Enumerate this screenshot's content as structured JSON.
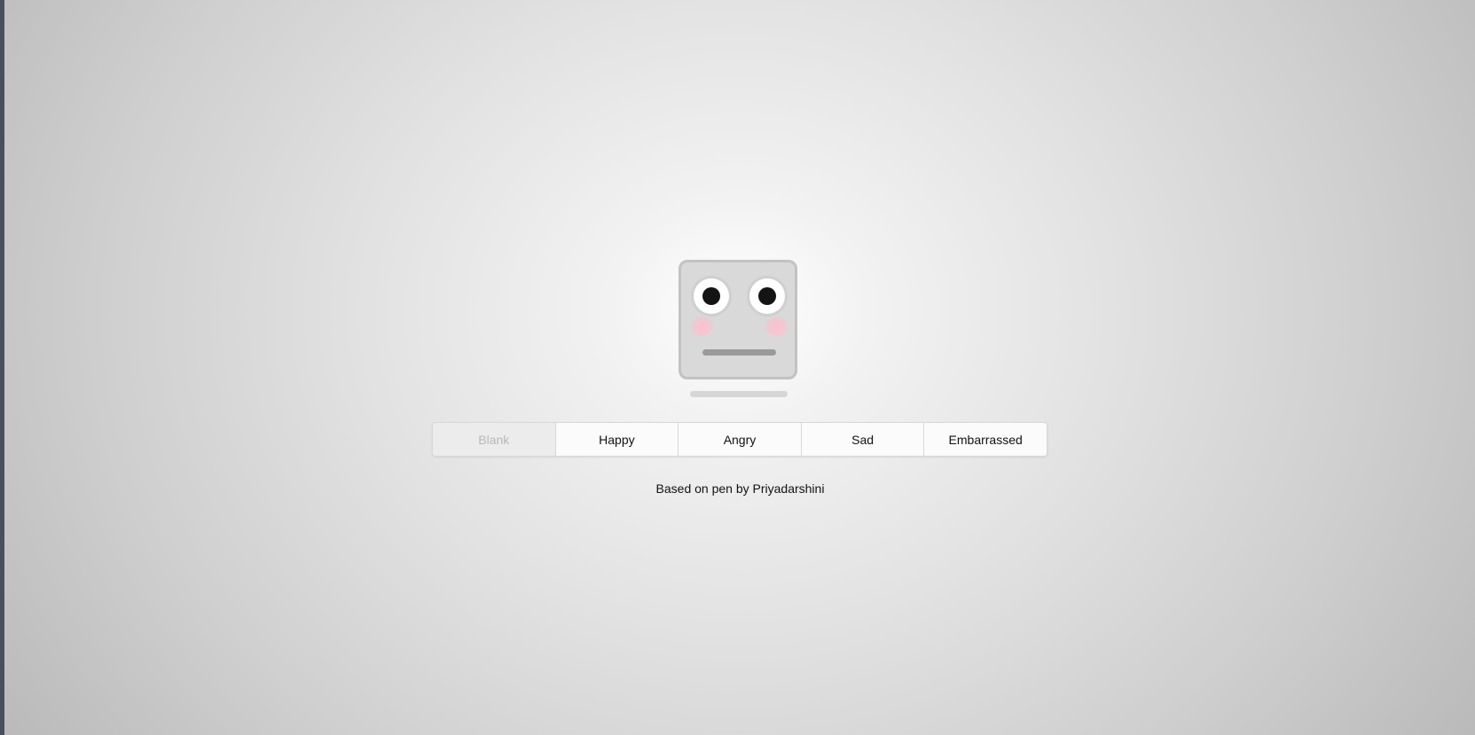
{
  "moods": [
    {
      "label": "Blank",
      "selected": true
    },
    {
      "label": "Happy",
      "selected": false
    },
    {
      "label": "Angry",
      "selected": false
    },
    {
      "label": "Sad",
      "selected": false
    },
    {
      "label": "Embarrassed",
      "selected": false
    }
  ],
  "credit": "Based on pen by Priyadarshini",
  "colors": {
    "face_fill": "#d9d9d9",
    "face_border": "#c2c2c2",
    "pupil": "#141414",
    "blush": "#ffbecd",
    "mouth": "#9a9a9a",
    "active_text": "#b8b8b8"
  }
}
